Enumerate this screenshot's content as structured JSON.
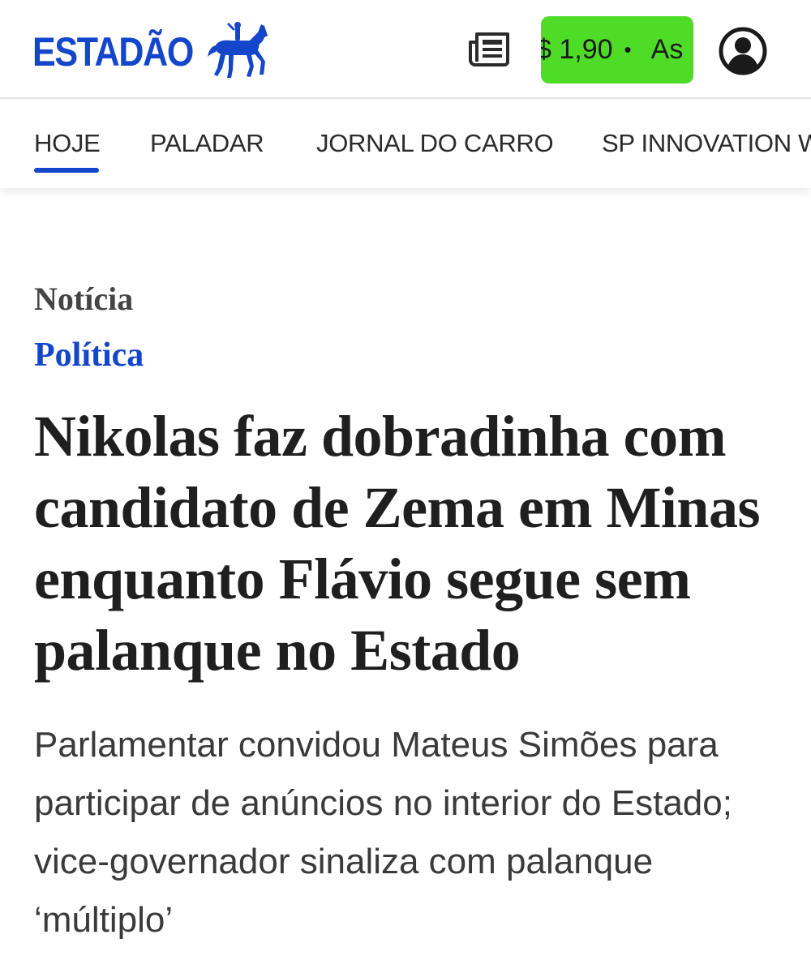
{
  "header": {
    "logo_text": "ESTADÃO",
    "logo_icon": "horse-rider-icon",
    "brand_color": "#1446cc",
    "news_icon": "newspaper-icon",
    "subscribe_button": {
      "price_text": "$ 1,90",
      "separator": "•",
      "cta_text": "As",
      "background": "#4fdc27"
    },
    "account_icon": "user-account-icon"
  },
  "nav": {
    "items": [
      {
        "label": "HOJE",
        "active": true
      },
      {
        "label": "PALADAR",
        "active": false
      },
      {
        "label": "JORNAL DO CARRO",
        "active": false
      },
      {
        "label": "SP INNOVATION W",
        "active": false
      }
    ]
  },
  "article": {
    "kicker": "Notícia",
    "section": "Política",
    "headline": "Nikolas faz dobradinha com candidato de Zema em Minas enquanto Flávio segue sem palanque no Estado",
    "lede": "Parlamentar convidou Mateus Simões para participar de anúncios no interior do Estado; vice-governador sinaliza com palanque ‘múltiplo’"
  }
}
